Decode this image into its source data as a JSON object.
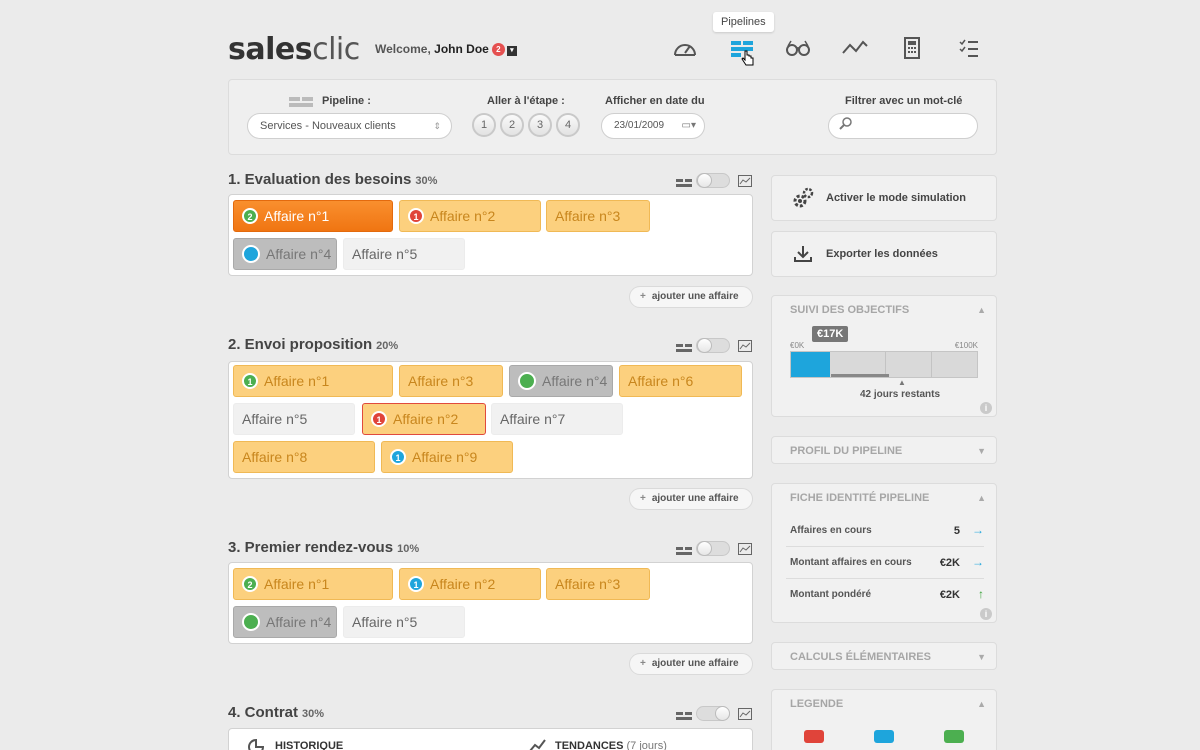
{
  "header": {
    "logo_a": "sales",
    "logo_b": "clic",
    "welcome": "Welcome,",
    "user": "John Doe",
    "notif_count": "2",
    "tooltip": "Pipelines",
    "nav_icons": [
      "dashboard-icon",
      "pipelines-icon",
      "glasses-icon",
      "trend-icon",
      "calculator-icon",
      "checklist-icon"
    ]
  },
  "filters": {
    "pipeline_label": "Pipeline :",
    "pipeline_value": "Services - Nouveaux clients",
    "goto_label": "Aller à l'étape :",
    "steps": [
      "1",
      "2",
      "3",
      "4"
    ],
    "date_label": "Afficher en date du",
    "date_value": "23/01/2009",
    "keyword_label": "Filtrer avec un mot-clé",
    "keyword_placeholder": ""
  },
  "stages": [
    {
      "title": "1. Evaluation des besoins",
      "pct": "30%",
      "deals": [
        {
          "label": "Affaire n°1",
          "style": "active",
          "badge": "2",
          "badge_color": "green"
        },
        {
          "label": "Affaire n°2",
          "style": "orange",
          "badge": "1",
          "badge_color": "red"
        },
        {
          "label": "Affaire n°3",
          "style": "orange"
        },
        {
          "label": "Affaire n°4",
          "style": "grey",
          "badge": "",
          "badge_color": "blue"
        },
        {
          "label": "Affaire n°5",
          "style": "light"
        }
      ]
    },
    {
      "title": "2. Envoi proposition",
      "pct": "20%",
      "deals": [
        {
          "label": "Affaire n°1",
          "style": "orange",
          "badge": "1",
          "badge_color": "green"
        },
        {
          "label": "Affaire n°3",
          "style": "orange"
        },
        {
          "label": "Affaire n°4",
          "style": "grey",
          "badge": "",
          "badge_color": "green"
        },
        {
          "label": "Affaire n°6",
          "style": "orange"
        },
        {
          "label": "Affaire n°5",
          "style": "light"
        },
        {
          "label": "Affaire n°2",
          "style": "orange-red",
          "badge": "1",
          "badge_color": "red"
        },
        {
          "label": "Affaire n°7",
          "style": "light"
        },
        {
          "label": "Affaire n°8",
          "style": "orange"
        },
        {
          "label": "Affaire n°9",
          "style": "orange",
          "badge": "1",
          "badge_color": "blue"
        }
      ]
    },
    {
      "title": "3. Premier rendez-vous",
      "pct": "10%",
      "deals": [
        {
          "label": "Affaire n°1",
          "style": "orange",
          "badge": "2",
          "badge_color": "green"
        },
        {
          "label": "Affaire n°2",
          "style": "orange",
          "badge": "1",
          "badge_color": "blue"
        },
        {
          "label": "Affaire n°3",
          "style": "orange"
        },
        {
          "label": "Affaire n°4",
          "style": "grey",
          "badge": "",
          "badge_color": "green"
        },
        {
          "label": "Affaire n°5",
          "style": "light"
        }
      ]
    },
    {
      "title": "4. Contrat",
      "pct": "30%",
      "tabs": [
        "HISTORIQUE",
        "TENDANCES",
        "(7 jours)"
      ]
    }
  ],
  "add_deal_label": "ajouter une affaire",
  "right": {
    "simulation": "Activer le mode simulation",
    "export": "Exporter les données",
    "objectives": {
      "title": "SUIVI DES OBJECTIFS",
      "min": "€0K",
      "max": "€100K",
      "current": "€17K",
      "progress": 0.17,
      "remaining": "42 jours restants"
    },
    "profile_title": "PROFIL DU PIPELINE",
    "identity": {
      "title": "FICHE IDENTITÉ PIPELINE",
      "rows": [
        {
          "label": "Affaires en cours",
          "value": "5",
          "arrow": "→",
          "arrow_color": "#1ea5dc"
        },
        {
          "label": "Montant affaires en cours",
          "value": "€2K",
          "arrow": "→",
          "arrow_color": "#1ea5dc"
        },
        {
          "label": "Montant pondéré",
          "value": "€2K",
          "arrow": "↑",
          "arrow_color": "#3aa33a"
        }
      ]
    },
    "calc_title": "CALCULS ÉLÉMENTAIRES",
    "legend": {
      "title": "LEGENDE",
      "colors": [
        "#e0443a",
        "#1ea5dc",
        "#4caf50"
      ]
    }
  }
}
